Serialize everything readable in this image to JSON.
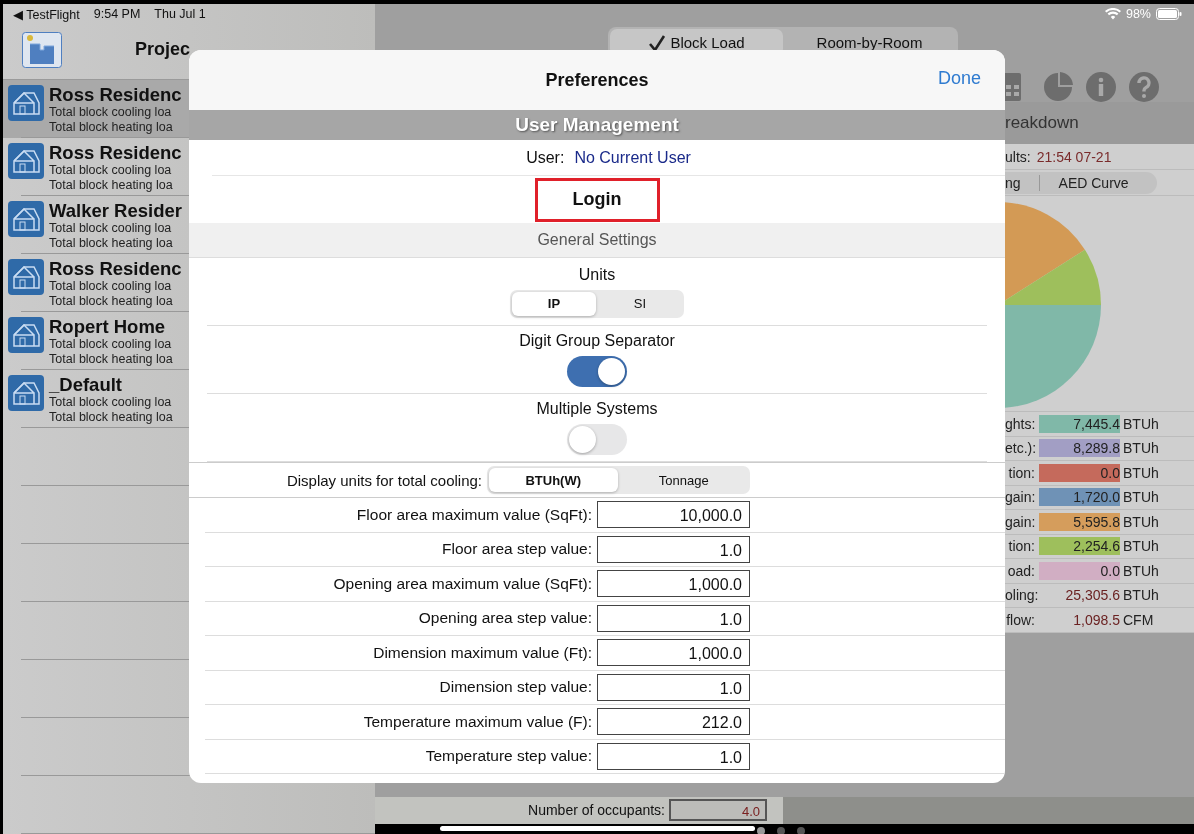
{
  "status_bar": {
    "back_label": "◀ TestFlight",
    "time": "9:54 PM",
    "date": "Thu Jul 1",
    "battery": "98%"
  },
  "sidebar": {
    "title": "Projec",
    "projects": [
      {
        "name": "Ross Residenc",
        "lines": [
          "Total block cooling loa",
          "Total block heating loa"
        ],
        "selected": true
      },
      {
        "name": "Ross Residenc",
        "lines": [
          "Total block cooling loa",
          "Total block heating loa"
        ],
        "selected": false
      },
      {
        "name": "Walker Resider",
        "lines": [
          "Total block cooling loa",
          "Total block heating loa"
        ],
        "selected": false
      },
      {
        "name": "Ross Residenc",
        "lines": [
          "Total block cooling loa",
          "Total block heating loa"
        ],
        "selected": false
      },
      {
        "name": "Ropert Home",
        "lines": [
          "Total block cooling loa",
          "Total block heating loa"
        ],
        "selected": false
      },
      {
        "name": "_Default",
        "lines": [
          "Total block cooling loa",
          "Total block heating loa"
        ],
        "selected": false
      }
    ]
  },
  "main": {
    "tabs": [
      {
        "label": "Block Load",
        "selected": true
      },
      {
        "label": "Room-by-Room",
        "selected": false
      }
    ],
    "breakdown": {
      "title": "reakdown",
      "results_label": "ults:",
      "results_time": "21:54 07-21",
      "views": [
        {
          "label": "ng",
          "selected": false
        },
        {
          "label": "AED Curve",
          "selected": false
        }
      ],
      "legend": [
        {
          "kind": "swatch",
          "label": "ghts:",
          "value": "7,445.4",
          "unit": "BTUh",
          "color": "#80b8a8"
        },
        {
          "kind": "swatch",
          "label": "etc.):",
          "value": "8,289.8",
          "unit": "BTUh",
          "color": "#a29ec4"
        },
        {
          "kind": "swatch",
          "label": "tion:",
          "value": "0.0",
          "unit": "BTUh",
          "color": "#c56a5c"
        },
        {
          "kind": "swatch",
          "label": "gain:",
          "value": "1,720.0",
          "unit": "BTUh",
          "color": "#6f92b6"
        },
        {
          "kind": "swatch",
          "label": "gain:",
          "value": "5,595.8",
          "unit": "BTUh",
          "color": "#d59d5c"
        },
        {
          "kind": "swatch",
          "label": "tion:",
          "value": "2,254.6",
          "unit": "BTUh",
          "color": "#9ebf5c"
        },
        {
          "kind": "swatch",
          "label": "oad:",
          "value": "0.0",
          "unit": "BTUh",
          "color": "#d1aec3"
        },
        {
          "kind": "total",
          "label": "oling:",
          "value": "25,305.6",
          "unit": "BTUh"
        },
        {
          "kind": "total",
          "label": "flow:",
          "value": "1,098.5",
          "unit": "CFM"
        }
      ]
    },
    "occupants": {
      "label": "Number of occupants:",
      "value": "4.0"
    }
  },
  "preferences": {
    "title": "Preferences",
    "done": "Done",
    "rows": [
      {
        "kind": "header",
        "title": "User Management"
      },
      {
        "kind": "user",
        "label": "User:",
        "value": "No Current User"
      },
      {
        "kind": "button",
        "label": "Login",
        "highlighted": true
      },
      {
        "kind": "subheader",
        "title": "General Settings"
      },
      {
        "kind": "segmented",
        "label": "Units",
        "options": [
          {
            "label": "IP",
            "selected": true
          },
          {
            "label": "SI",
            "selected": false
          }
        ]
      },
      {
        "kind": "toggle",
        "label": "Digit Group Separator",
        "on": true
      },
      {
        "kind": "toggle",
        "label": "Multiple Systems",
        "on": false
      },
      {
        "kind": "inline-segmented",
        "label": "Display units for total cooling:",
        "options": [
          {
            "label": "BTUh(W)",
            "selected": true
          },
          {
            "label": "Tonnage",
            "selected": false
          }
        ]
      },
      {
        "kind": "number",
        "label": "Floor area maximum value (SqFt):",
        "value": "10,000.0"
      },
      {
        "kind": "number",
        "label": "Floor area step value:",
        "value": "1.0"
      },
      {
        "kind": "number",
        "label": "Opening area maximum value (SqFt):",
        "value": "1,000.0"
      },
      {
        "kind": "number",
        "label": "Opening area step value:",
        "value": "1.0"
      },
      {
        "kind": "number",
        "label": "Dimension maximum value (Ft):",
        "value": "1,000.0"
      },
      {
        "kind": "number",
        "label": "Dimension step value:",
        "value": "1.0"
      },
      {
        "kind": "number",
        "label": "Temperature maximum value (F):",
        "value": "212.0"
      },
      {
        "kind": "number",
        "label": "Temperature step value:",
        "value": "1.0"
      }
    ]
  }
}
